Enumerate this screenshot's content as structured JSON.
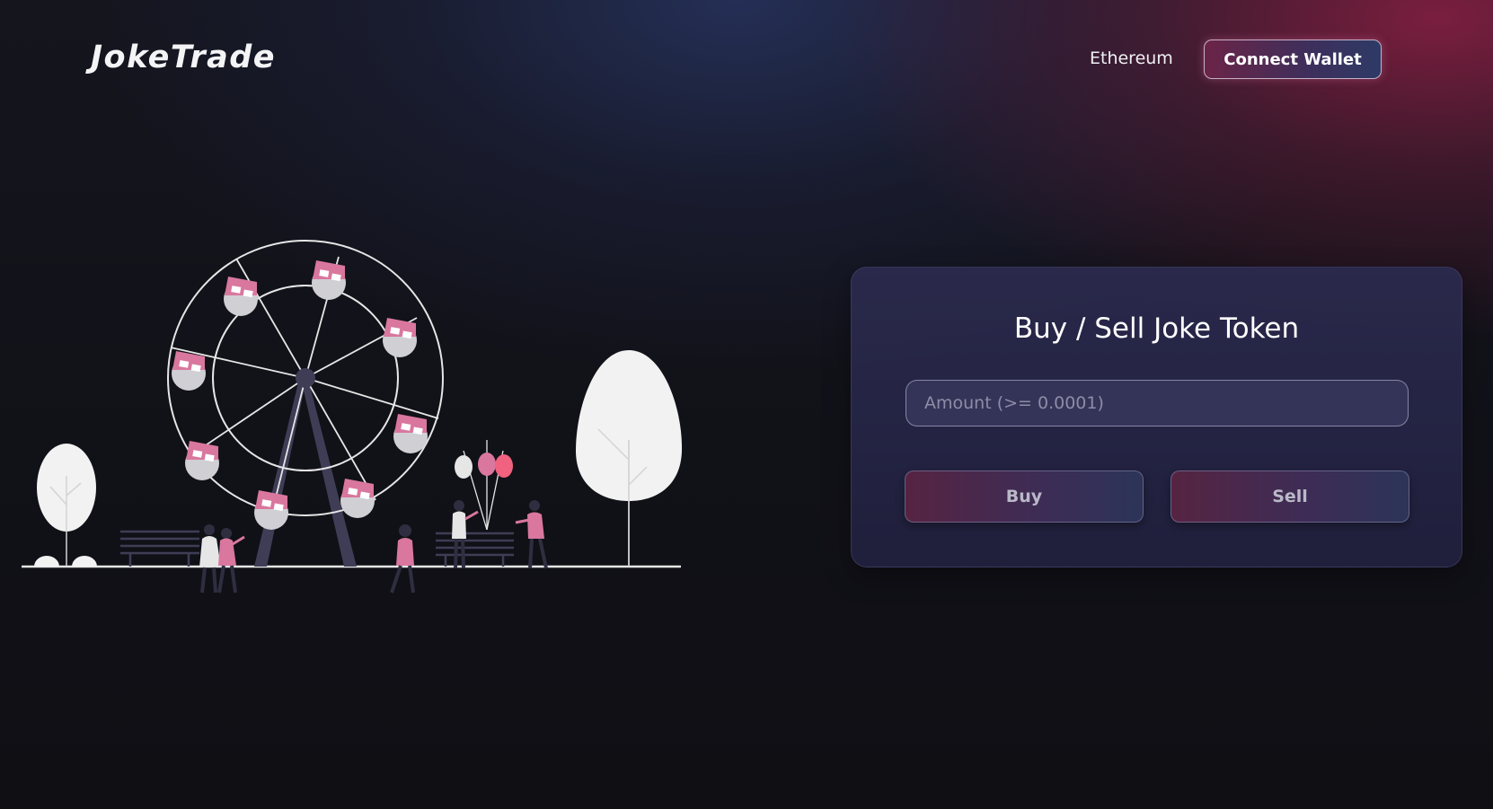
{
  "header": {
    "logo": "JokeTrade",
    "network": "Ethereum",
    "connect_label": "Connect Wallet"
  },
  "trade_card": {
    "title": "Buy / Sell Joke Token",
    "amount_placeholder": "Amount (>= 0.0001)",
    "amount_value": "",
    "buy_label": "Buy",
    "sell_label": "Sell"
  },
  "colors": {
    "background": "#0f0f14",
    "accent_pink": "#d9779e",
    "accent_red": "#f0627f",
    "card_background": "#2b2a4e",
    "illustration_dark": "#3f3d56",
    "illustration_light": "#f2f2f2"
  }
}
